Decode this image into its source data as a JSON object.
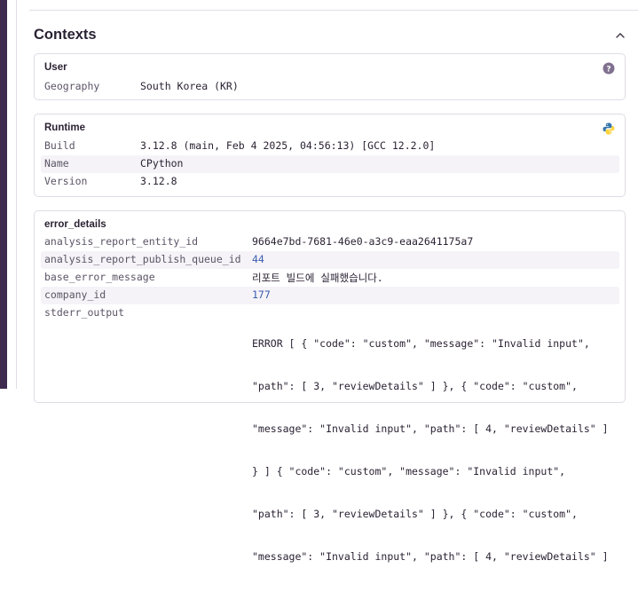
{
  "contexts": {
    "title": "Contexts",
    "user": {
      "title": "User",
      "rows": [
        {
          "key": "Geography",
          "value": "South Korea (KR)"
        }
      ]
    },
    "runtime": {
      "title": "Runtime",
      "rows": [
        {
          "key": "Build",
          "value": "3.12.8 (main, Feb 4 2025, 04:56:13) [GCC 12.2.0]"
        },
        {
          "key": "Name",
          "value": "CPython"
        },
        {
          "key": "Version",
          "value": "3.12.8"
        }
      ]
    },
    "error_details": {
      "title": "error_details",
      "rows": [
        {
          "key": "analysis_report_entity_id",
          "value": "9664e7bd-7681-46e0-a3c9-eaa2641175a7"
        },
        {
          "key": "analysis_report_publish_queue_id",
          "value": "44"
        },
        {
          "key": "base_error_message",
          "value": "리포트 빌드에 실패했습니다."
        },
        {
          "key": "company_id",
          "value": "177"
        },
        {
          "key": "stderr_output",
          "value": ""
        }
      ],
      "stderr_lines": [
        "ERROR [ { \"code\": \"custom\", \"message\": \"Invalid input\",",
        "\"path\": [ 3, \"reviewDetails\" ] }, { \"code\": \"custom\",",
        "\"message\": \"Invalid input\", \"path\": [ 4, \"reviewDetails\" ]",
        "} ] { \"code\": \"custom\", \"message\": \"Invalid input\",",
        "\"path\": [ 3, \"reviewDetails\" ] }, { \"code\": \"custom\",",
        "\"message\": \"Invalid input\", \"path\": [ 4, \"reviewDetails\" ]"
      ]
    }
  },
  "colors": {
    "sidebar": "#3e2a4f",
    "row_alt": "#f5f3f7",
    "number": "#3b5bb0",
    "python_blue": "#3776ab",
    "python_yellow": "#ffd43b"
  },
  "icons": {
    "collapse": "chevron-up-icon",
    "user": "question-icon",
    "runtime": "python-icon"
  }
}
